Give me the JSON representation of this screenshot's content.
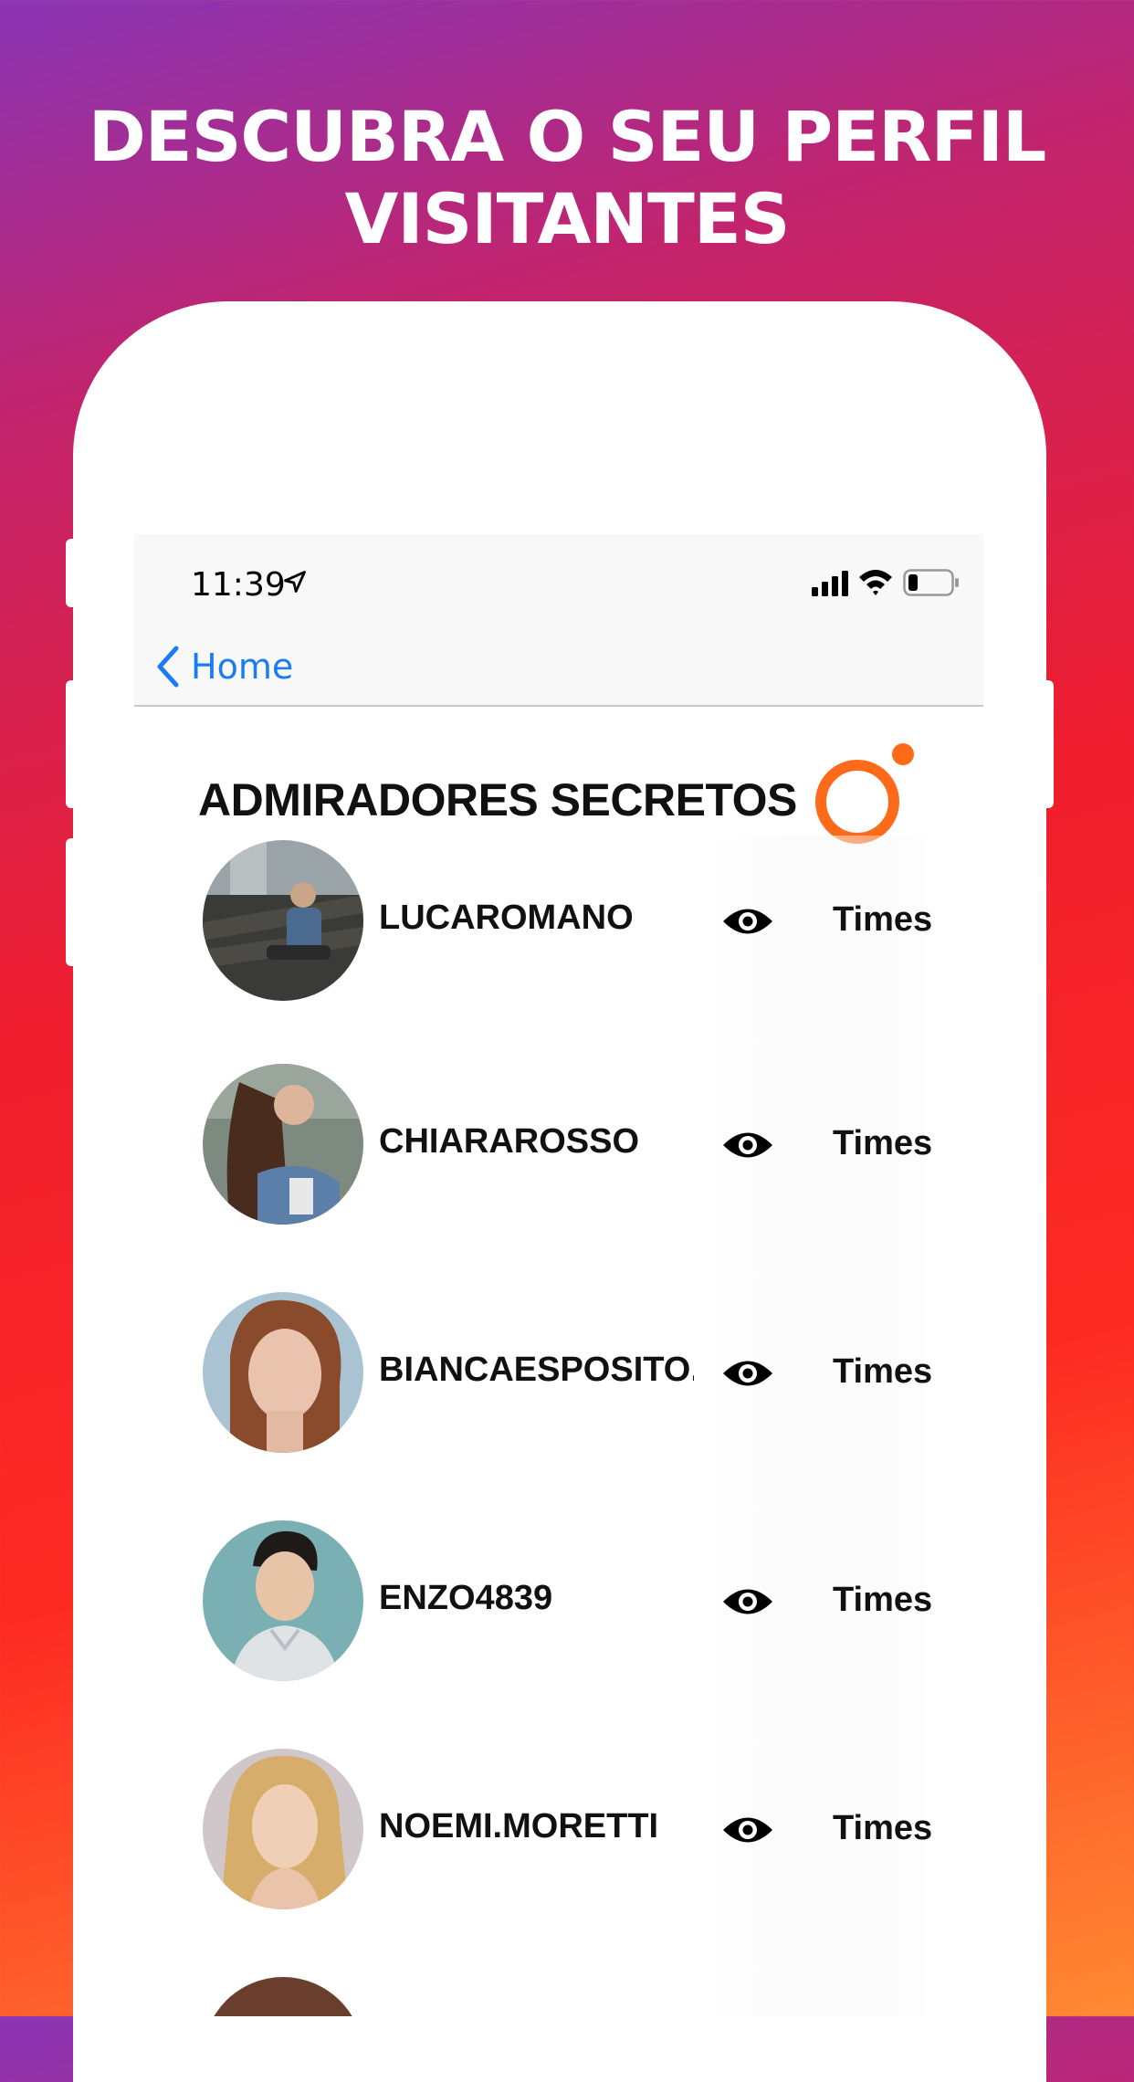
{
  "headline": {
    "line1": "DESCUBRA O SEU PERFIL",
    "line2": "VISITANTES"
  },
  "status_bar": {
    "time": "11:39",
    "icons": [
      "location-arrow-icon",
      "signal-bars-icon",
      "wifi-icon",
      "battery-icon"
    ]
  },
  "nav": {
    "back_label": "Home"
  },
  "section": {
    "title": "ADMIRADORES SECRETOS",
    "logo_color": "#ff6a1a"
  },
  "visitors": [
    {
      "username": "LUCAROMANO",
      "count_label": "Times"
    },
    {
      "username": "CHIARAROSSO",
      "count_label": "Times"
    },
    {
      "username": "BIANCAESPOSITO.",
      "count_label": "Times"
    },
    {
      "username": "ENZO4839",
      "count_label": "Times"
    },
    {
      "username": "NOEMI.MORETTI",
      "count_label": "Times"
    }
  ],
  "colors": {
    "accent_blue": "#1a7cf2",
    "gradient_top": "#8a35b5",
    "gradient_mid": "#f01e2e",
    "gradient_bottom": "#ff8a32"
  }
}
